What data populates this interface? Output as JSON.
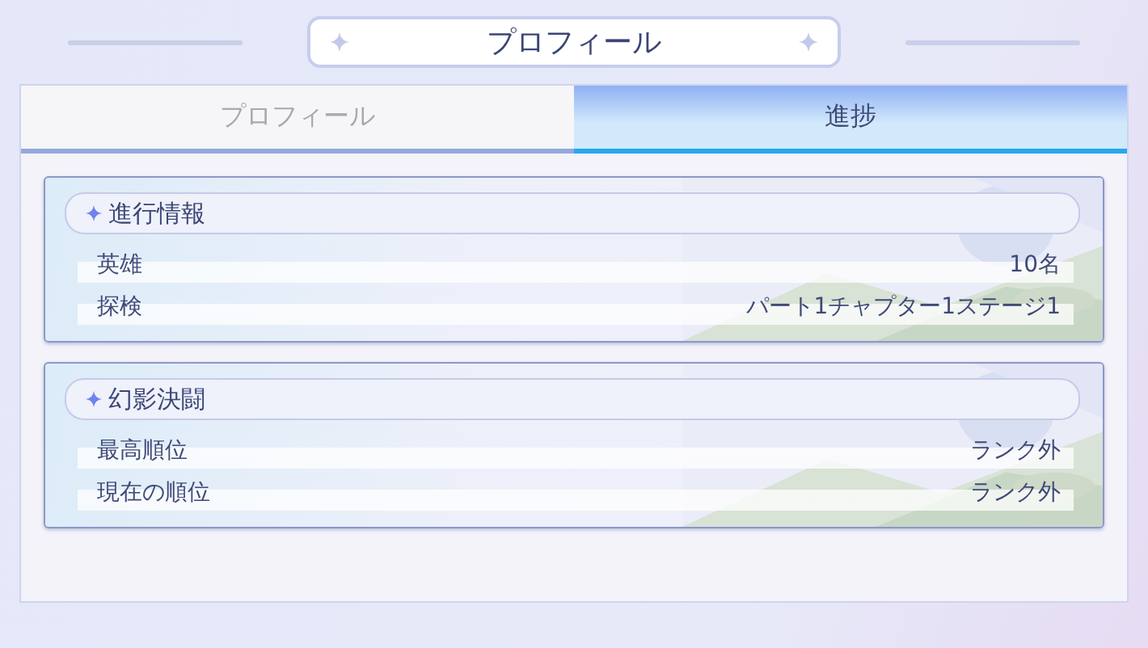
{
  "title": "プロフィール",
  "tabs": [
    {
      "label": "プロフィール",
      "selected": false
    },
    {
      "label": "進捗",
      "selected": true
    }
  ],
  "sections": [
    {
      "title": "進行情報",
      "rows": [
        {
          "label": "英雄",
          "value": "10名"
        },
        {
          "label": "探検",
          "value": "パート1チャプター1ステージ1"
        }
      ]
    },
    {
      "title": "幻影決闘",
      "rows": [
        {
          "label": "最高順位",
          "value": "ランク外"
        },
        {
          "label": "現在の順位",
          "value": "ランク外"
        }
      ]
    }
  ]
}
